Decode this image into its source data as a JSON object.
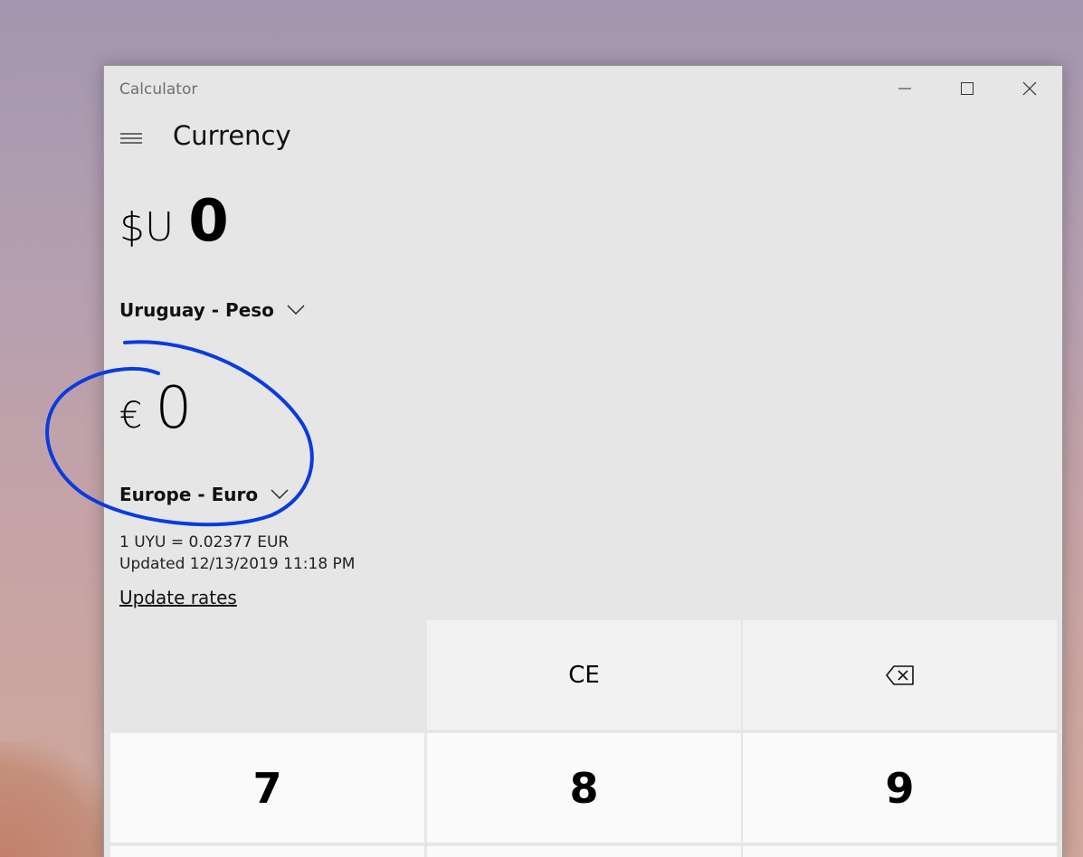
{
  "window": {
    "app_title": "Calculator",
    "mode_title": "Currency"
  },
  "from": {
    "symbol": "$U",
    "value": "0",
    "currency_name": "Uruguay - Peso"
  },
  "to": {
    "symbol": "€",
    "value": "0",
    "currency_name": "Europe - Euro"
  },
  "rates": {
    "rate_text": "1 UYU = 0.02377 EUR",
    "updated_text": "Updated 12/13/2019 11:18 PM",
    "update_link": "Update rates"
  },
  "keypad": {
    "ce": "CE",
    "backspace_icon": "backspace-icon",
    "digits": [
      "7",
      "8",
      "9"
    ]
  },
  "annotation": {
    "color": "#0a3be0"
  },
  "colors": {
    "window_bg": "#e6e6e6",
    "digit_key_bg": "#fafafa",
    "function_key_bg": "#f2f2f2"
  }
}
